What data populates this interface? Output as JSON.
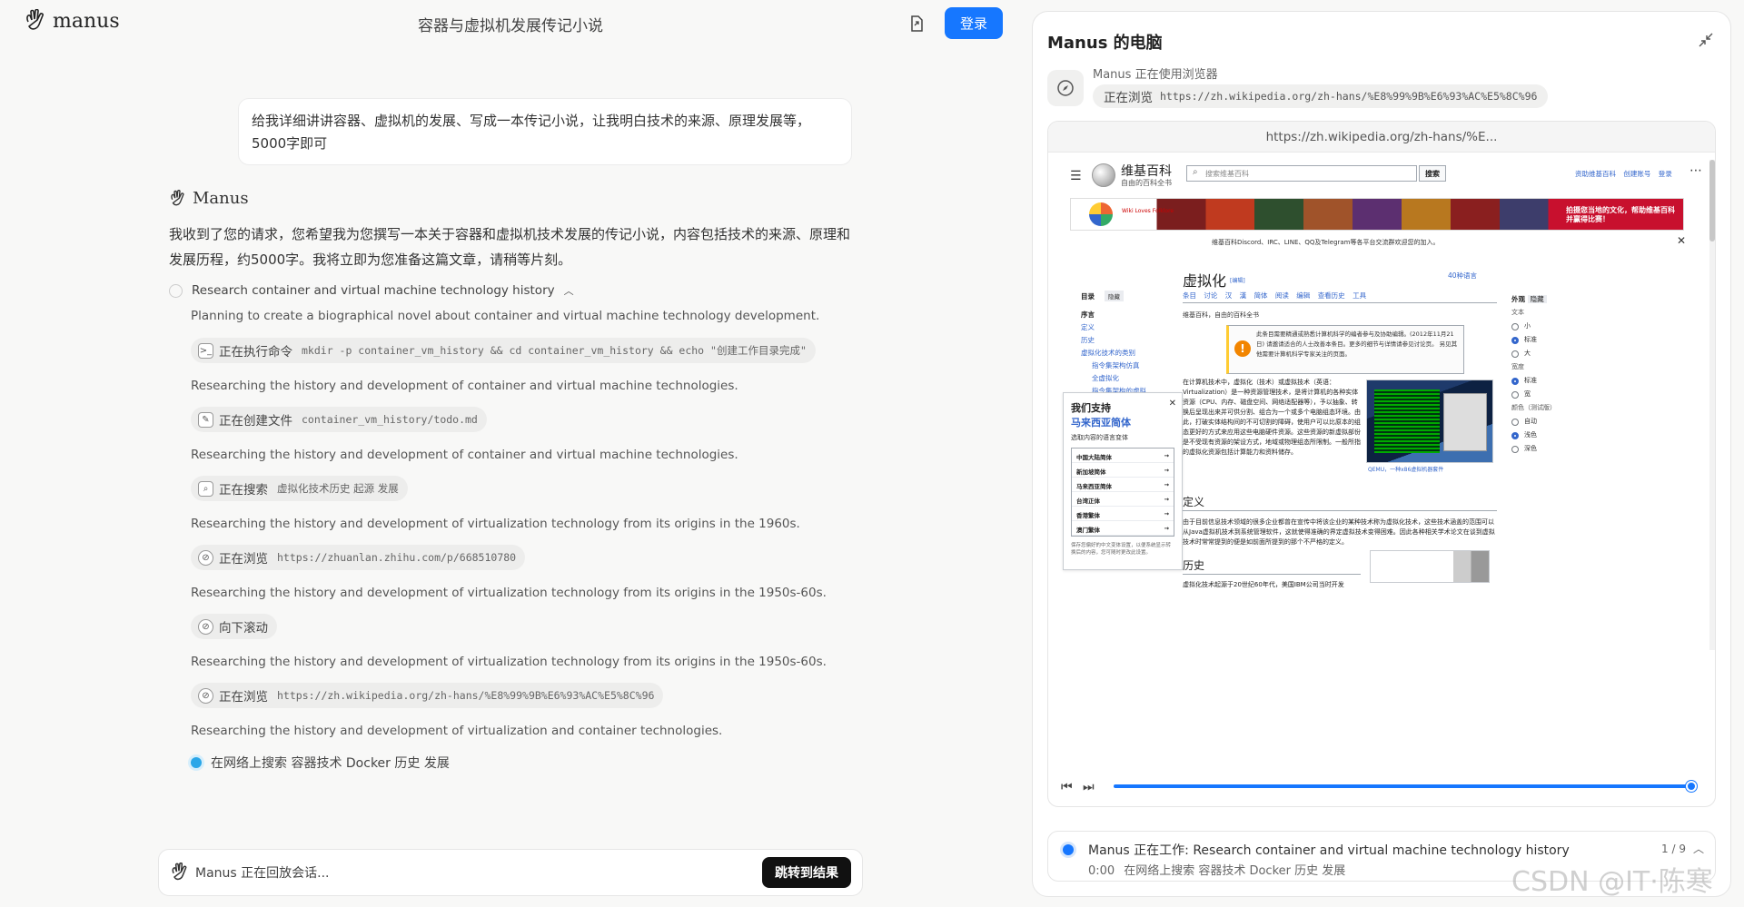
{
  "header": {
    "brand": "manus",
    "title": "容器与虚拟机发展传记小说",
    "login_label": "登录"
  },
  "chat": {
    "user_message": "给我详细讲讲容器、虚拟机的发展、写成一本传记小说，让我明白技术的来源、原理发展等，5000字即可",
    "assistant_name": "Manus",
    "assistant_reply": "我收到了您的请求，您希望我为您撰写一本关于容器和虚拟机技术发展的传记小说，内容包括技术的来源、原理和发展历程，约5000字。我将立即为您准备这篇文章，请稍等片刻。",
    "task_title": "Research container and virtual machine technology history",
    "steps": [
      {
        "text": "Planning to create a biographical novel about container and virtual machine technology development."
      },
      {
        "action": "正在执行命令",
        "arg": "mkdir -p container_vm_history && cd container_vm_history && echo \"创建工作目录完成\""
      },
      {
        "text": "Researching the history and development of container and virtual machine technologies."
      },
      {
        "action": "正在创建文件",
        "arg": "container_vm_history/todo.md"
      },
      {
        "text": "Researching the history and development of container and virtual machine technologies."
      },
      {
        "action": "正在搜索",
        "arg": "虚拟化技术历史 起源 发展"
      },
      {
        "text": "Researching the history and development of virtualization technology from its origins in the 1960s."
      },
      {
        "action": "正在浏览",
        "arg": "https://zhuanlan.zhihu.com/p/668510780"
      },
      {
        "text": "Researching the history and development of virtualization technology from its origins in the 1950s-60s."
      },
      {
        "action": "向下滚动",
        "arg": ""
      },
      {
        "text": "Researching the history and development of virtualization technology from its origins in the 1950s-60s."
      },
      {
        "action": "正在浏览",
        "arg": "https://zh.wikipedia.org/zh-hans/%E8%99%9B%E6%93%AC%E5%8C%96"
      },
      {
        "text": "Researching the history and development of virtualization and container technologies."
      }
    ],
    "active_step": "在网络上搜索 容器技术 Docker 历史 发展"
  },
  "replay": {
    "status": "Manus 正在回放会话...",
    "jump_label": "跳转到结果"
  },
  "computer": {
    "title": "Manus 的电脑",
    "status_label": "Manus 正在使用浏览器",
    "status_action": "正在浏览",
    "status_url": "https://zh.wikipedia.org/zh-hans/%E8%99%9B%E6%93%AC%E5%8C%96",
    "browser_url": "https://zh.wikipedia.org/zh-hans/%E...",
    "progress": 1.0
  },
  "wiki": {
    "logo_title": "维基百科",
    "logo_sub": "自由的百科全书",
    "search_placeholder": "搜索维基百科",
    "search_btn": "搜索",
    "top_links": "资助维基百科 创建账号 登录",
    "banner_brand": "Wiki Loves Folklore",
    "banner_text": "拍摄您当地的文化，帮助维基百科并赢得比赛！",
    "notice": "维基百科Discord、IRC、LINE、QQ及Telegram等各平台交流群欢迎您的加入。",
    "toc_title": "目录",
    "toc_hide": "隐藏",
    "toc_items": [
      "序言",
      "定义",
      "历史",
      "虚拟化技术的类别",
      "指令集架构仿真",
      "全虚拟化",
      "指令集架构的虚拟"
    ],
    "page_title": "虚拟化",
    "edit": "[编辑]",
    "langs": "40种语言",
    "tabs": "条目 讨论 汉 漢 简体 阅读 编辑 查看历史 工具",
    "from": "维基百科，自由的百科全书",
    "warning": "此条目需要精通或熟悉计算机科学的编者参与及协助编辑。(2012年11月21日) 请邀请适合的人士改善本条目。更多的细节与详情请参见讨论页。 另见其他需要计算机科学专家关注的页面。",
    "intro": "在计算机技术中，虚拟化（技术）或虚拟技术（英语：Virtualization）是一种资源管理技术，是将计算机的各种实体资源（CPU、内存、磁盘空间、网络适配器等），予以抽象、转换后呈现出来并可供分割、组合为一个或多个电脑组态环境。由此，打破实体结构间的不可切割的障碍，使用户可以比原本的组态更好的方式来应用这些电脑硬件资源。这些资源的新虚拟部份是不受现有资源的架设方式，地域或物理组态所限制。一般所指的虚拟化资源包括计算能力和资料储存。",
    "img_caption": "QEMU，一种x86虚拟机器套件",
    "donate_t1": "我们支持",
    "donate_t2": "马来西亚简体",
    "donate_t3": "选取内容的语言变体",
    "donate_list": [
      "中国大陆简体",
      "新加坡简体",
      "马来西亚简体",
      "台湾正体",
      "香港繁体",
      "澳门繁体"
    ],
    "donate_foot": "保存您偏好的中文变体设置，以便系统显示转换后的内容，您可随时更改此设置。",
    "h_def": "定义",
    "def_text": "由于目前信息技术领域的很多企业都曾在宣传中将该企业的某种技术称为虚拟化技术，这些技术涵盖的范围可以从Java虚拟机技术到系统管理软件，这就使得准确的界定虚拟技术变得困难。因此各种相关学术论文在谈到虚拟技术时常常提到的便是如前面所提到的那个不严格的定义。",
    "h_hist": "历史",
    "hist_text": "虚拟化技术起源于20世纪60年代，美国IBM公司当时开发",
    "appearance": "外观",
    "appearance_hide": "隐藏",
    "text_label": "文本",
    "text_opts": [
      "小",
      "标准",
      "大"
    ],
    "width_label": "宽度",
    "width_opts": [
      "标准",
      "宽"
    ],
    "color_label": "颜色（测试版）",
    "color_opts": [
      "自动",
      "浅色",
      "深色"
    ]
  },
  "work": {
    "title": "Manus 正在工作: Research container and virtual machine technology history",
    "time": "0:00",
    "detail": "在网络上搜索 容器技术 Docker 历史 发展",
    "count": "1 / 9"
  },
  "watermark": "CSDN @IT·陈寒"
}
